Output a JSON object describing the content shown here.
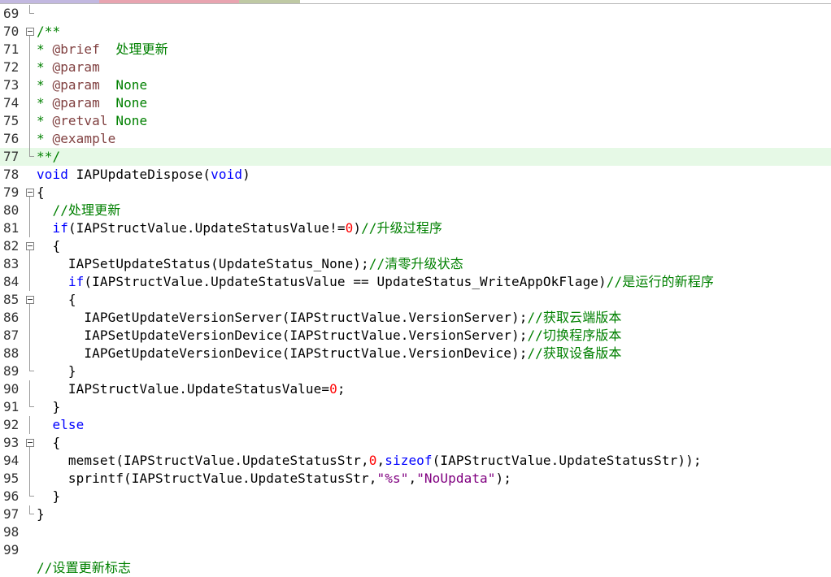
{
  "colors": {
    "comment": "#008000",
    "doc_tag": "#804040",
    "keyword": "#0000ff",
    "number": "#ff0000",
    "string": "#800080",
    "text": "#000000",
    "current_line": "#e6f9e6",
    "tab_segments": [
      "#c2b8e0",
      "#e8a4b0",
      "#f4d4dc",
      "#bfc9a4"
    ]
  },
  "lines": [
    {
      "num": "69",
      "fold": "end",
      "tokens": []
    },
    {
      "num": "70",
      "fold": "box",
      "tokens": [
        {
          "t": "/**",
          "c": "comment"
        }
      ]
    },
    {
      "num": "71",
      "fold": "line",
      "tokens": [
        {
          "t": "* ",
          "c": "comment"
        },
        {
          "t": "@brief",
          "c": "doc_tag"
        },
        {
          "t": "  处理更新",
          "c": "comment"
        }
      ]
    },
    {
      "num": "72",
      "fold": "line",
      "tokens": [
        {
          "t": "* ",
          "c": "comment"
        },
        {
          "t": "@param",
          "c": "doc_tag"
        }
      ]
    },
    {
      "num": "73",
      "fold": "line",
      "tokens": [
        {
          "t": "* ",
          "c": "comment"
        },
        {
          "t": "@param",
          "c": "doc_tag"
        },
        {
          "t": "  None",
          "c": "comment"
        }
      ]
    },
    {
      "num": "74",
      "fold": "line",
      "tokens": [
        {
          "t": "* ",
          "c": "comment"
        },
        {
          "t": "@param",
          "c": "doc_tag"
        },
        {
          "t": "  None",
          "c": "comment"
        }
      ]
    },
    {
      "num": "75",
      "fold": "line",
      "tokens": [
        {
          "t": "* ",
          "c": "comment"
        },
        {
          "t": "@retval",
          "c": "doc_tag"
        },
        {
          "t": " None",
          "c": "comment"
        }
      ]
    },
    {
      "num": "76",
      "fold": "line",
      "tokens": [
        {
          "t": "* ",
          "c": "comment"
        },
        {
          "t": "@example",
          "c": "doc_tag"
        }
      ]
    },
    {
      "num": "77",
      "fold": "end",
      "highlight": true,
      "tokens": [
        {
          "t": "**/",
          "c": "comment"
        }
      ]
    },
    {
      "num": "78",
      "fold": "none",
      "tokens": [
        {
          "t": "void",
          "c": "keyword"
        },
        {
          "t": " IAPUpdateDispose(",
          "c": "text"
        },
        {
          "t": "void",
          "c": "keyword"
        },
        {
          "t": ")",
          "c": "text"
        }
      ]
    },
    {
      "num": "79",
      "fold": "box",
      "tokens": [
        {
          "t": "{",
          "c": "text"
        }
      ]
    },
    {
      "num": "80",
      "fold": "line",
      "tokens": [
        {
          "t": "  //处理更新",
          "c": "comment"
        }
      ]
    },
    {
      "num": "81",
      "fold": "line",
      "tokens": [
        {
          "t": "  ",
          "c": "text"
        },
        {
          "t": "if",
          "c": "keyword"
        },
        {
          "t": "(IAPStructValue.UpdateStatusValue!=",
          "c": "text"
        },
        {
          "t": "0",
          "c": "number"
        },
        {
          "t": ")",
          "c": "text"
        },
        {
          "t": "//升级过程序",
          "c": "comment"
        }
      ]
    },
    {
      "num": "82",
      "fold": "box",
      "tokens": [
        {
          "t": "  {",
          "c": "text"
        }
      ]
    },
    {
      "num": "83",
      "fold": "line",
      "tokens": [
        {
          "t": "    IAPSetUpdateStatus(UpdateStatus_None);",
          "c": "text"
        },
        {
          "t": "//清零升级状态",
          "c": "comment"
        }
      ]
    },
    {
      "num": "84",
      "fold": "line",
      "tokens": [
        {
          "t": "    ",
          "c": "text"
        },
        {
          "t": "if",
          "c": "keyword"
        },
        {
          "t": "(IAPStructValue.UpdateStatusValue == UpdateStatus_WriteAppOkFlage)",
          "c": "text"
        },
        {
          "t": "//是运行的新程序",
          "c": "comment"
        }
      ]
    },
    {
      "num": "85",
      "fold": "box",
      "tokens": [
        {
          "t": "    {",
          "c": "text"
        }
      ]
    },
    {
      "num": "86",
      "fold": "line",
      "tokens": [
        {
          "t": "      IAPGetUpdateVersionServer(IAPStructValue.VersionServer);",
          "c": "text"
        },
        {
          "t": "//获取云端版本",
          "c": "comment"
        }
      ]
    },
    {
      "num": "87",
      "fold": "line",
      "tokens": [
        {
          "t": "      IAPSetUpdateVersionDevice(IAPStructValue.VersionServer);",
          "c": "text"
        },
        {
          "t": "//切换程序版本",
          "c": "comment"
        }
      ]
    },
    {
      "num": "88",
      "fold": "line",
      "tokens": [
        {
          "t": "      IAPGetUpdateVersionDevice(IAPStructValue.VersionDevice);",
          "c": "text"
        },
        {
          "t": "//获取设备版本",
          "c": "comment"
        }
      ]
    },
    {
      "num": "89",
      "fold": "end",
      "tokens": [
        {
          "t": "    }",
          "c": "text"
        }
      ]
    },
    {
      "num": "90",
      "fold": "line",
      "tokens": [
        {
          "t": "    IAPStructValue.UpdateStatusValue=",
          "c": "text"
        },
        {
          "t": "0",
          "c": "number"
        },
        {
          "t": ";",
          "c": "text"
        }
      ]
    },
    {
      "num": "91",
      "fold": "end",
      "tokens": [
        {
          "t": "  }",
          "c": "text"
        }
      ]
    },
    {
      "num": "92",
      "fold": "line",
      "tokens": [
        {
          "t": "  ",
          "c": "text"
        },
        {
          "t": "else",
          "c": "keyword"
        }
      ]
    },
    {
      "num": "93",
      "fold": "box",
      "tokens": [
        {
          "t": "  {",
          "c": "text"
        }
      ]
    },
    {
      "num": "94",
      "fold": "line",
      "tokens": [
        {
          "t": "    memset(IAPStructValue.UpdateStatusStr,",
          "c": "text"
        },
        {
          "t": "0",
          "c": "number"
        },
        {
          "t": ",",
          "c": "text"
        },
        {
          "t": "sizeof",
          "c": "keyword"
        },
        {
          "t": "(IAPStructValue.UpdateStatusStr));",
          "c": "text"
        }
      ]
    },
    {
      "num": "95",
      "fold": "line",
      "tokens": [
        {
          "t": "    sprintf(IAPStructValue.UpdateStatusStr,",
          "c": "text"
        },
        {
          "t": "\"%s\"",
          "c": "string"
        },
        {
          "t": ",",
          "c": "text"
        },
        {
          "t": "\"NoUpdata\"",
          "c": "string"
        },
        {
          "t": ");",
          "c": "text"
        }
      ]
    },
    {
      "num": "96",
      "fold": "end",
      "tokens": [
        {
          "t": "  }",
          "c": "text"
        }
      ]
    },
    {
      "num": "97",
      "fold": "end",
      "tokens": [
        {
          "t": "}",
          "c": "text"
        }
      ]
    },
    {
      "num": "98",
      "fold": "none",
      "tokens": []
    },
    {
      "num": "99",
      "fold": "none",
      "tokens": []
    },
    {
      "num": "",
      "fold": "none",
      "tokens": [
        {
          "t": "//设置更新标志",
          "c": "comment"
        }
      ]
    }
  ]
}
